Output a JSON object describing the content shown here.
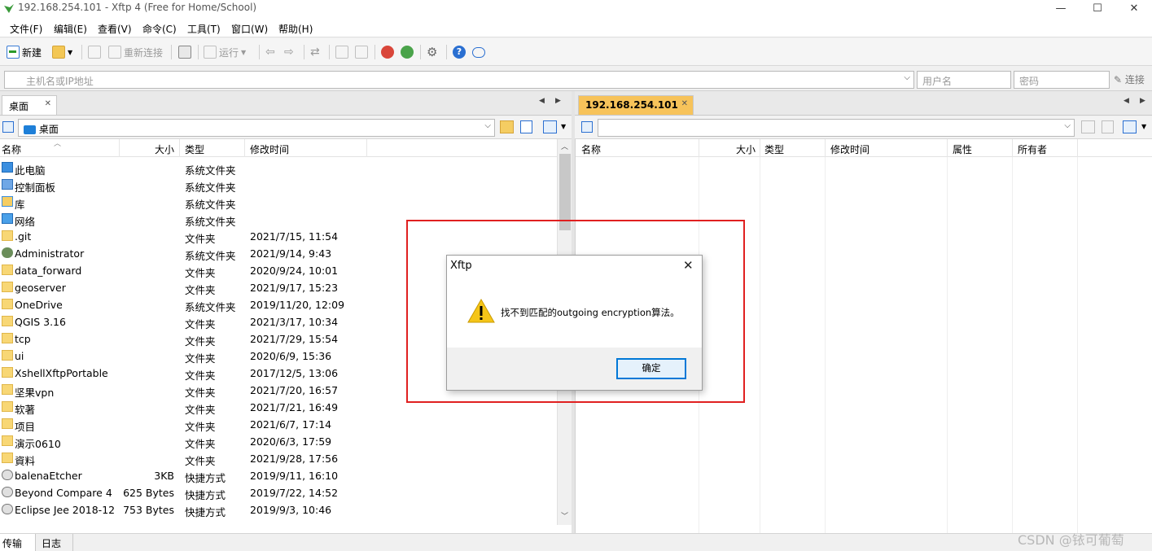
{
  "window": {
    "title": "192.168.254.101 - Xftp 4 (Free for Home/School)",
    "minimize": "—",
    "maximize": "☐",
    "close": "✕"
  },
  "menu": [
    "文件(F)",
    "编辑(E)",
    "查看(V)",
    "命令(C)",
    "工具(T)",
    "窗口(W)",
    "帮助(H)"
  ],
  "toolbar": {
    "new_label": "新建",
    "reconnect_label": "重新连接",
    "run_label": "运行"
  },
  "address": {
    "host_placeholder": "主机名或IP地址",
    "user_placeholder": "用户名",
    "password_placeholder": "密码",
    "connect_label": "连接"
  },
  "left_pane": {
    "tab_label": "桌面",
    "path": "桌面",
    "columns": [
      "名称",
      "大小",
      "类型",
      "修改时间"
    ],
    "files": [
      {
        "name": "此电脑",
        "size": "",
        "type": "系统文件夹",
        "modified": "",
        "icon": "computer"
      },
      {
        "name": "控制面板",
        "size": "",
        "type": "系统文件夹",
        "modified": "",
        "icon": "control-panel"
      },
      {
        "name": "库",
        "size": "",
        "type": "系统文件夹",
        "modified": "",
        "icon": "library"
      },
      {
        "name": "网络",
        "size": "",
        "type": "系统文件夹",
        "modified": "",
        "icon": "network"
      },
      {
        "name": ".git",
        "size": "",
        "type": "文件夹",
        "modified": "2021/7/15, 11:54",
        "icon": "folder"
      },
      {
        "name": "Administrator",
        "size": "",
        "type": "系统文件夹",
        "modified": "2021/9/14, 9:43",
        "icon": "user"
      },
      {
        "name": "data_forward",
        "size": "",
        "type": "文件夹",
        "modified": "2020/9/24, 10:01",
        "icon": "folder"
      },
      {
        "name": "geoserver",
        "size": "",
        "type": "文件夹",
        "modified": "2021/9/17, 15:23",
        "icon": "folder"
      },
      {
        "name": "OneDrive",
        "size": "",
        "type": "系统文件夹",
        "modified": "2019/11/20, 12:09",
        "icon": "folder"
      },
      {
        "name": "QGIS 3.16",
        "size": "",
        "type": "文件夹",
        "modified": "2021/3/17, 10:34",
        "icon": "folder"
      },
      {
        "name": "tcp",
        "size": "",
        "type": "文件夹",
        "modified": "2021/7/29, 15:54",
        "icon": "folder"
      },
      {
        "name": "ui",
        "size": "",
        "type": "文件夹",
        "modified": "2020/6/9, 15:36",
        "icon": "folder"
      },
      {
        "name": "XshellXftpPortable",
        "size": "",
        "type": "文件夹",
        "modified": "2017/12/5, 13:06",
        "icon": "folder"
      },
      {
        "name": "坚果vpn",
        "size": "",
        "type": "文件夹",
        "modified": "2021/7/20, 16:57",
        "icon": "folder"
      },
      {
        "name": "软著",
        "size": "",
        "type": "文件夹",
        "modified": "2021/7/21, 16:49",
        "icon": "folder"
      },
      {
        "name": "项目",
        "size": "",
        "type": "文件夹",
        "modified": "2021/6/7, 17:14",
        "icon": "folder"
      },
      {
        "name": "演示0610",
        "size": "",
        "type": "文件夹",
        "modified": "2020/6/3, 17:59",
        "icon": "folder"
      },
      {
        "name": "資料",
        "size": "",
        "type": "文件夹",
        "modified": "2021/9/28, 17:56",
        "icon": "folder"
      },
      {
        "name": "balenaEtcher",
        "size": "3KB",
        "type": "快捷方式",
        "modified": "2019/9/11, 16:10",
        "icon": "shortcut"
      },
      {
        "name": "Beyond Compare 4",
        "size": "625 Bytes",
        "type": "快捷方式",
        "modified": "2019/7/22, 14:52",
        "icon": "shortcut"
      },
      {
        "name": "Eclipse Jee 2018-12",
        "size": "753 Bytes",
        "type": "快捷方式",
        "modified": "2019/9/3, 10:46",
        "icon": "shortcut"
      }
    ]
  },
  "right_pane": {
    "tab_label": "192.168.254.101",
    "columns": [
      "名称",
      "大小",
      "类型",
      "修改时间",
      "属性",
      "所有者"
    ]
  },
  "dialog": {
    "title": "Xftp",
    "message": "找不到匹配的outgoing encryption算法。",
    "ok_label": "确定"
  },
  "bottom_tabs": [
    "传输",
    "日志"
  ],
  "watermark": "CSDN @铱可葡萄"
}
